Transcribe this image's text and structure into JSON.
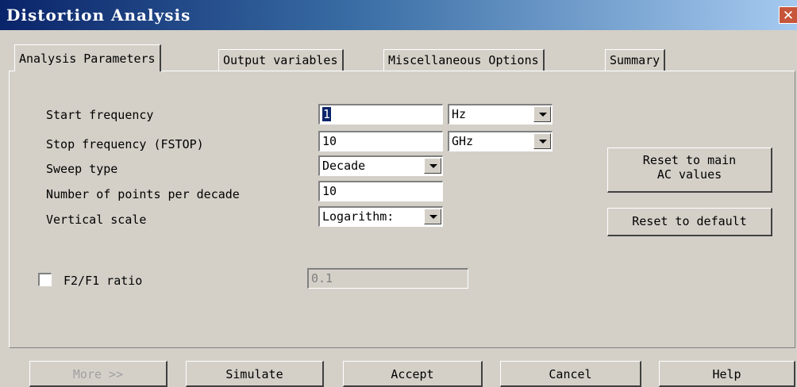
{
  "window": {
    "title": "Distortion Analysis",
    "close_glyph": "✕"
  },
  "tabs": [
    {
      "label": "Analysis Parameters",
      "active": true
    },
    {
      "label": "Output variables",
      "active": false
    },
    {
      "label": "Miscellaneous Options",
      "active": false
    },
    {
      "label": "Summary",
      "active": false
    }
  ],
  "fields": {
    "start_frequency": {
      "label": "Start frequency",
      "value": "1",
      "unit": "Hz"
    },
    "stop_frequency": {
      "label": "Stop frequency (FSTOP)",
      "value": "10",
      "unit": "GHz"
    },
    "sweep_type": {
      "label": "Sweep type",
      "value": "Decade"
    },
    "points_per_decade": {
      "label": "Number of points per decade",
      "value": "10"
    },
    "vertical_scale": {
      "label": "Vertical scale",
      "value": "Logarithm:"
    },
    "f2f1_ratio": {
      "label": "F2/F1 ratio",
      "checked": false,
      "value": "0.1"
    }
  },
  "side_buttons": {
    "reset_main_ac": "Reset to main\nAC values",
    "reset_default": "Reset to default"
  },
  "bottom_buttons": {
    "more": "More >>",
    "simulate": "Simulate",
    "accept": "Accept",
    "cancel": "Cancel",
    "help": "Help"
  },
  "colors": {
    "titlebar_start": "#0a246a",
    "titlebar_end": "#a6caf0",
    "dialog_face": "#d4d0c8",
    "close_button": "#c7553a"
  }
}
